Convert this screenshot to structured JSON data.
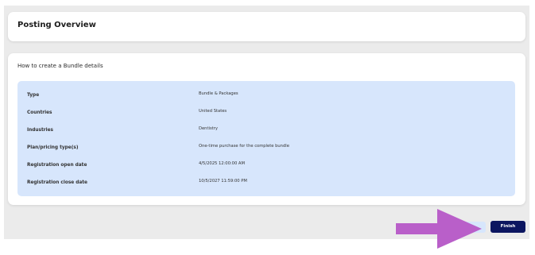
{
  "header": {
    "title": "Posting Overview"
  },
  "details": {
    "section_title": "How to create a Bundle details",
    "rows": [
      {
        "label": "Type",
        "value": "Bundle & Packages"
      },
      {
        "label": "Countries",
        "value": "United States"
      },
      {
        "label": "Industries",
        "value": "Dentistry"
      },
      {
        "label": "Plan/pricing type(s)",
        "value": "One-time purchase for the complete bundle"
      },
      {
        "label": "Registration open date",
        "value": "4/5/2025 12:00:00 AM"
      },
      {
        "label": "Registration close date",
        "value": "10/5/2027 11:59:00 PM"
      }
    ]
  },
  "footer": {
    "finish_label": "Finish"
  },
  "annotation": {
    "arrow_color": "#b95fc9",
    "icon": "arrow-right-icon"
  },
  "colors": {
    "panel_background": "#d7e6fc",
    "primary_button": "#0c1660",
    "page_background": "#ebebeb"
  }
}
